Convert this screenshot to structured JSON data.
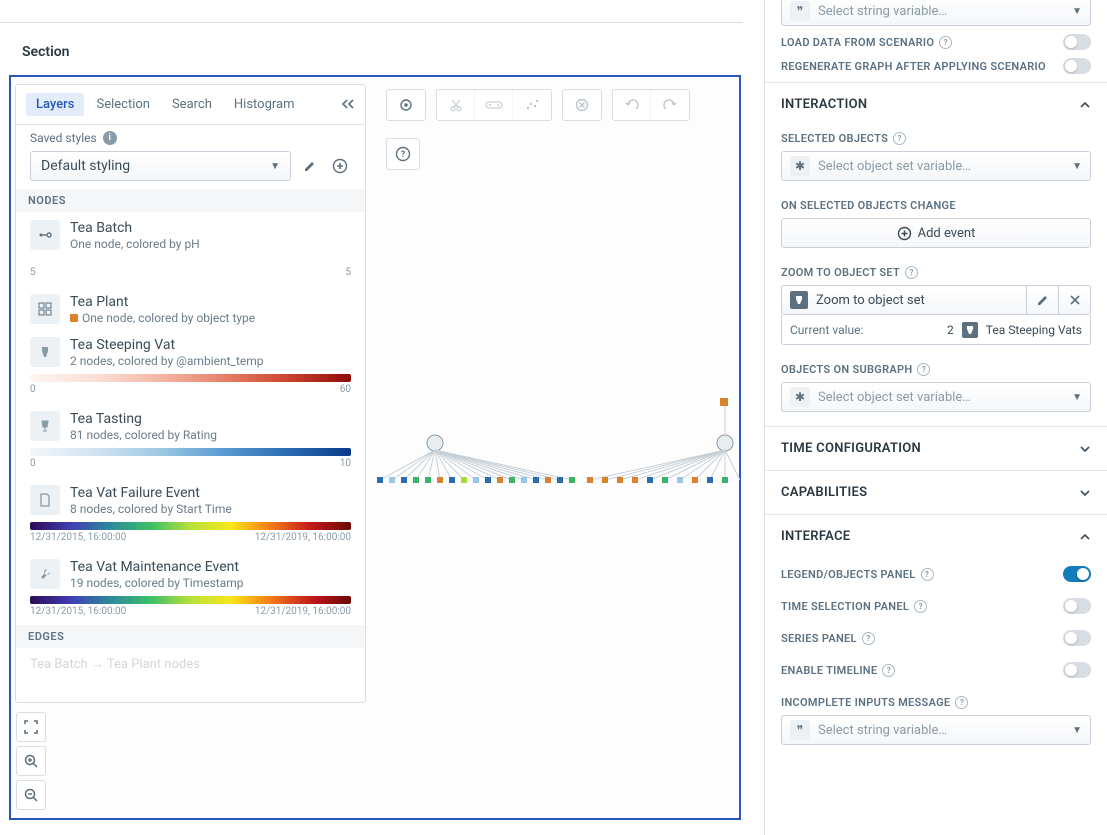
{
  "section_label": "Section",
  "tabs": {
    "layers": "Layers",
    "selection": "Selection",
    "search": "Search",
    "histogram": "Histogram"
  },
  "saved_styles_label": "Saved styles",
  "style_select_value": "Default styling",
  "nodes_header": "NODES",
  "edges_header": "EDGES",
  "layers": [
    {
      "title": "Tea Batch",
      "sub": "One node, colored by pH",
      "bar_min": "5",
      "bar_max": "5",
      "gradient": "linear-gradient(90deg,#3b0b5c,#3347b3,#1a8fa0,#39b36b,#a7d83c,#f5e81e)"
    },
    {
      "title": "Tea Plant",
      "sub": "One node, colored by object type",
      "swatch": true
    },
    {
      "title": "Tea Steeping Vat",
      "sub": "2 nodes, colored by @ambient_temp",
      "bar_min": "0",
      "bar_max": "60",
      "gradient": "linear-gradient(90deg,#fef5f2,#fadfd6,#f4b8a5,#e7816b,#cc4530,#8f0a0a)"
    },
    {
      "title": "Tea Tasting",
      "sub": "81 nodes, colored by Rating",
      "bar_min": "0",
      "bar_max": "10",
      "gradient": "linear-gradient(90deg,#f2f7fc,#d2e3f3,#9ecae1,#5a9bd4,#2a6db2,#0a3a8a)"
    },
    {
      "title": "Tea Vat Failure Event",
      "sub": "8 nodes, colored by Start Time",
      "bar_min": "12/31/2015, 16:00:00",
      "bar_max": "12/31/2019, 16:00:00",
      "gradient": "linear-gradient(90deg,#2d0a55,#3f3db3,#2d8a9b,#3abf66,#b7e03c,#f9e61a,#f57b17,#c11a1a,#6b0707)"
    },
    {
      "title": "Tea Vat Maintenance Event",
      "sub": "19 nodes, colored by Timestamp",
      "bar_min": "12/31/2015, 16:00:00",
      "bar_max": "12/31/2019, 16:00:00",
      "gradient": "linear-gradient(90deg,#2d0a55,#3f3db3,#2d8a9b,#3abf66,#b7e03c,#f9e61a,#f57b17,#c11a1a,#6b0707)"
    }
  ],
  "edge_row": "Tea Batch → Tea Plant nodes",
  "right": {
    "string_var_placeholder": "Select string variable…",
    "load_data_label": "LOAD DATA FROM SCENARIO",
    "regen_label": "REGENERATE GRAPH AFTER APPLYING SCENARIO",
    "interaction_header": "INTERACTION",
    "selected_objects_label": "SELECTED OBJECTS",
    "object_set_placeholder": "Select object set variable…",
    "on_selected_change": "ON SELECTED OBJECTS CHANGE",
    "add_event": "Add event",
    "zoom_to_object_set_label": "ZOOM TO OBJECT SET",
    "zoom_value": "Zoom to object set",
    "current_value_label": "Current value:",
    "current_count": "2",
    "current_name": "Tea Steeping Vats",
    "objects_on_subgraph": "OBJECTS ON SUBGRAPH",
    "time_config": "TIME CONFIGURATION",
    "capabilities": "CAPABILITIES",
    "interface": "INTERFACE",
    "legend_panel": "LEGEND/OBJECTS PANEL",
    "time_selection_panel": "TIME SELECTION PANEL",
    "series_panel": "SERIES PANEL",
    "enable_timeline": "ENABLE TIMELINE",
    "incomplete_inputs": "INCOMPLETE INPUTS MESSAGE"
  }
}
